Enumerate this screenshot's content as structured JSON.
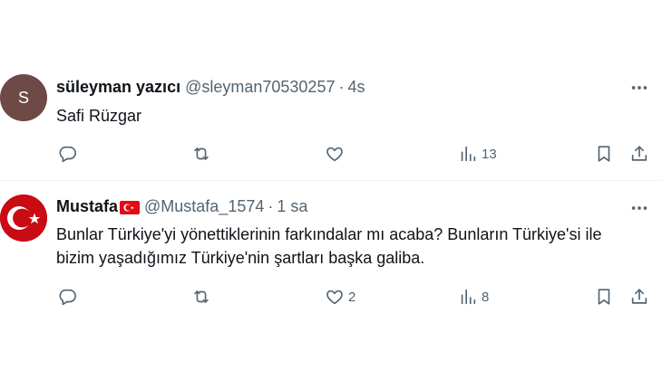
{
  "tweets": [
    {
      "avatar_letter": "S",
      "display_name": "süleyman yazıcı",
      "handle": "@sleyman70530257",
      "separator": "·",
      "time": "4s",
      "text_lines": [
        "Safi Rüzgar"
      ],
      "reply_count": "",
      "retweet_count": "",
      "like_count": "",
      "view_count": "13"
    },
    {
      "display_name": "Mustafa",
      "has_flag": true,
      "handle": "@Mustafa_1574",
      "separator": "·",
      "time": "1 sa",
      "text_lines": [
        "Bunlar Türkiye'yi yönettiklerinin farkındalar mı acaba? Bunların Türkiye'si ile",
        "bizim yaşadığımız Türkiye'nin şartları başka galiba."
      ],
      "reply_count": "",
      "retweet_count": "",
      "like_count": "2",
      "view_count": "8"
    }
  ],
  "colors": {
    "text_primary": "#0f1419",
    "text_secondary": "#536471",
    "divider": "#eff3f4",
    "avatar_1": "#6d4a45",
    "flag_red": "#e30a17"
  },
  "icons": [
    "more-icon",
    "reply-icon",
    "retweet-icon",
    "like-icon",
    "views-icon",
    "bookmark-icon",
    "share-icon"
  ]
}
